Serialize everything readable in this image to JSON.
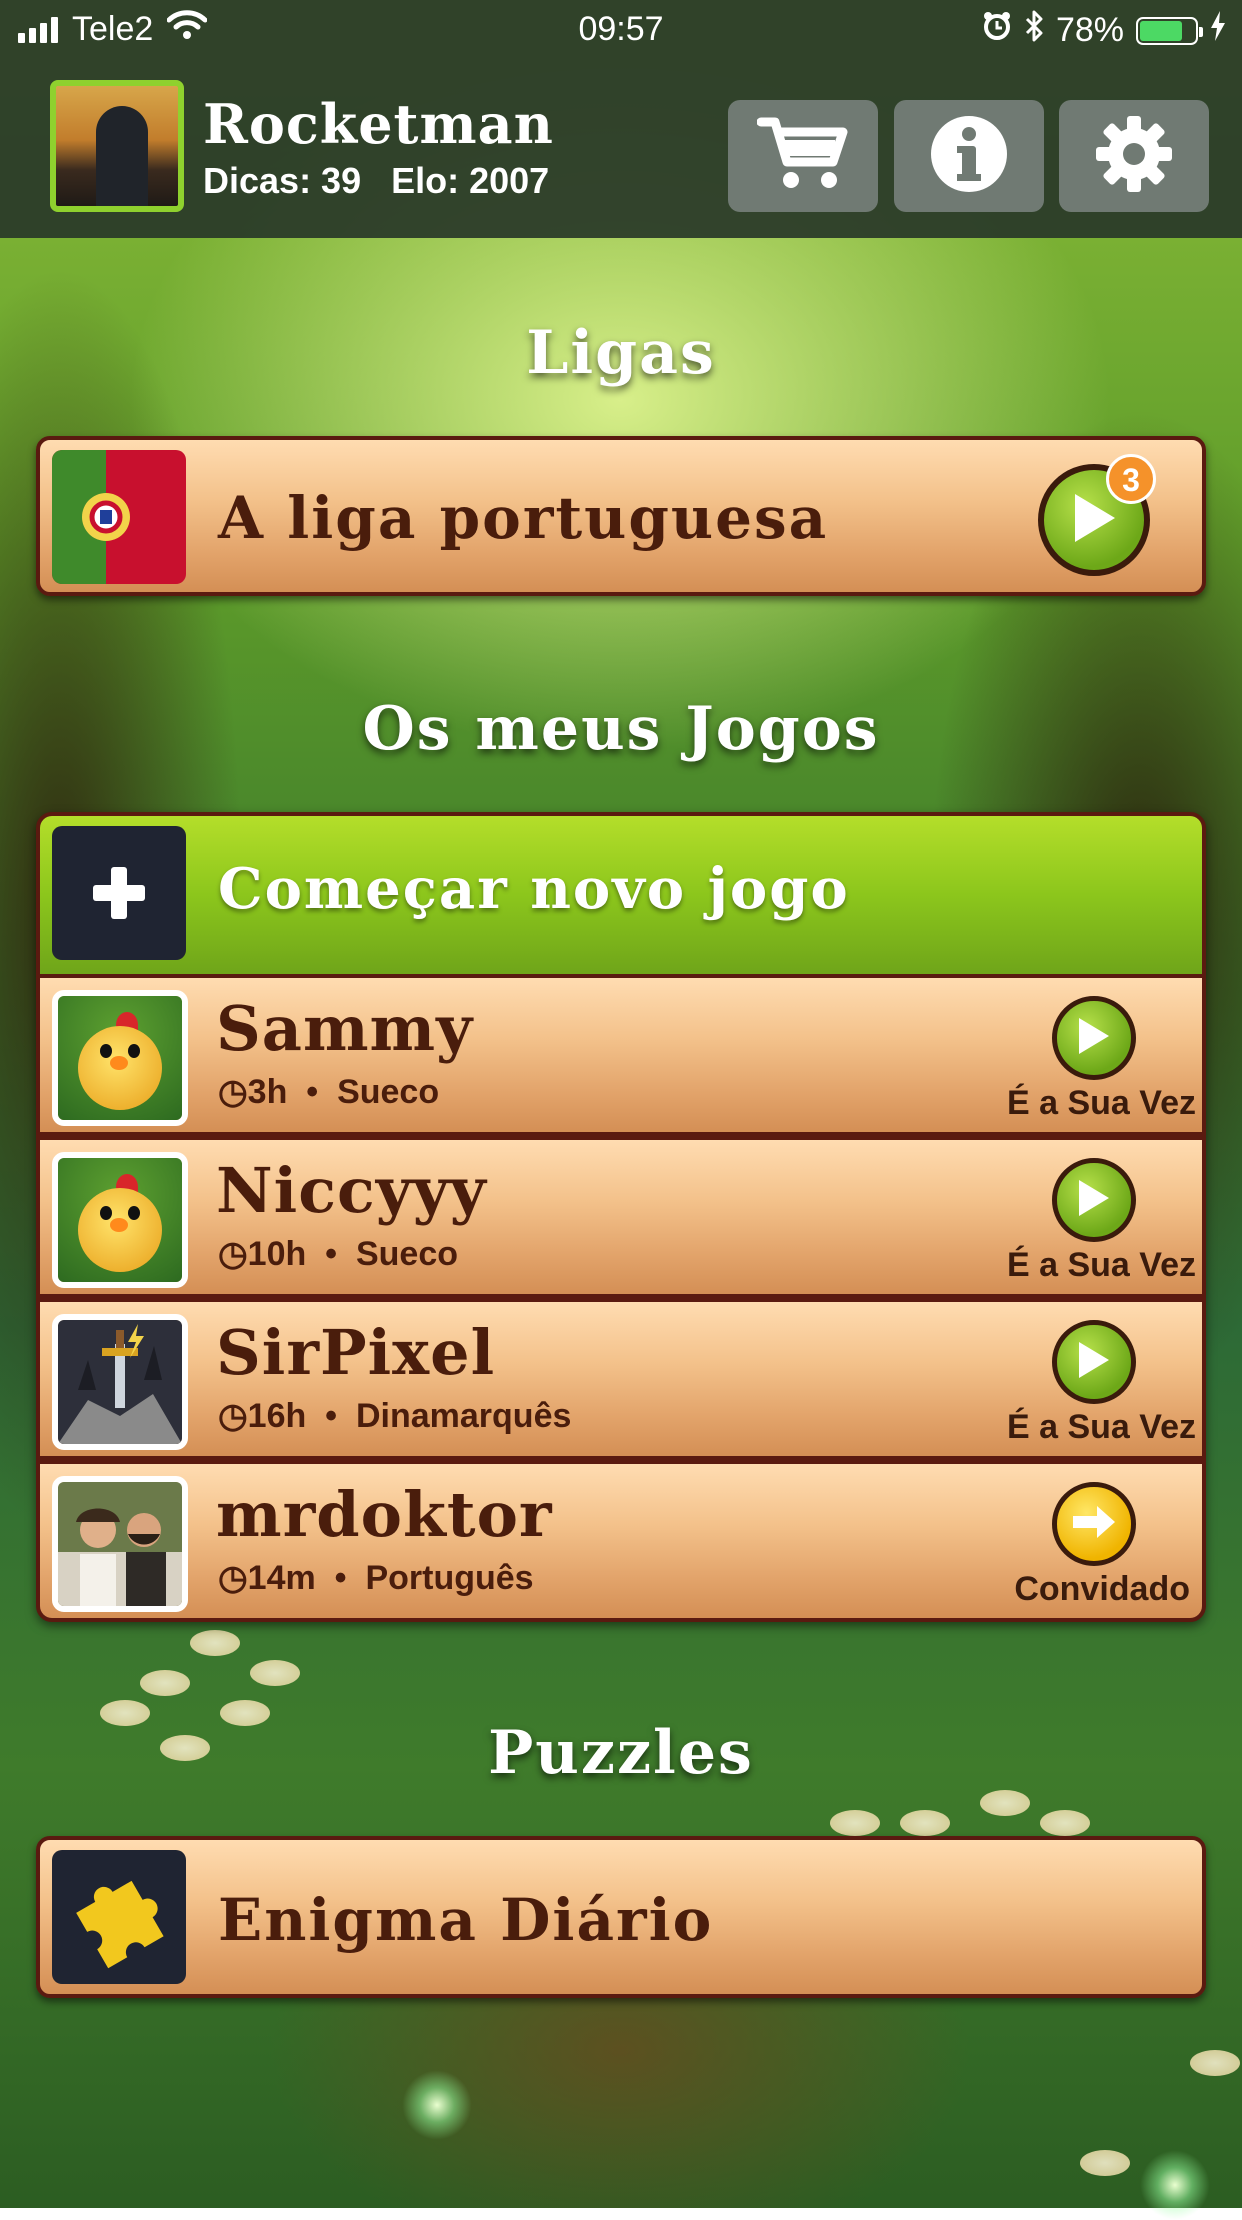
{
  "status_bar": {
    "carrier": "Tele2",
    "time": "09:57",
    "battery": "78%",
    "battery_level": 0.78
  },
  "user": {
    "name": "Rocketman",
    "hints": "Dicas: 39",
    "elo": "Elo: 2007"
  },
  "header_buttons": [
    {
      "name": "cart-icon"
    },
    {
      "name": "info-icon"
    },
    {
      "name": "gear-icon"
    }
  ],
  "leagues": {
    "title": "Ligas",
    "item": {
      "label": "A liga portuguesa",
      "badge": "3",
      "flag": "portugal-flag"
    }
  },
  "games": {
    "title": "Os meus Jogos",
    "new_game_label": "Começar novo jogo",
    "list": [
      {
        "name": "Sammy",
        "time": "◷3h",
        "language": "Sueco",
        "status": "É a Sua Vez",
        "avatar": "chick-avatar",
        "action": "play"
      },
      {
        "name": "Niccyyy",
        "time": "◷10h",
        "language": "Sueco",
        "status": "É a Sua Vez",
        "avatar": "chick-avatar",
        "action": "play"
      },
      {
        "name": "SirPixel",
        "time": "◷16h",
        "language": "Dinamarquês",
        "status": "É a Sua Vez",
        "avatar": "sword-avatar",
        "action": "play"
      },
      {
        "name": "mrdoktor",
        "time": "◷14m",
        "language": "Português",
        "status": "Convidado",
        "avatar": "photo-avatar",
        "action": "arrow"
      }
    ],
    "separator": "•"
  },
  "puzzles": {
    "title": "Puzzles",
    "item_label": "Enigma Diário",
    "icon": "puzzle-piece-icon"
  },
  "colors": {
    "wood_text": "#4a1d0c",
    "accent_green": "#8cc61c",
    "frame": "#5a1a10"
  }
}
